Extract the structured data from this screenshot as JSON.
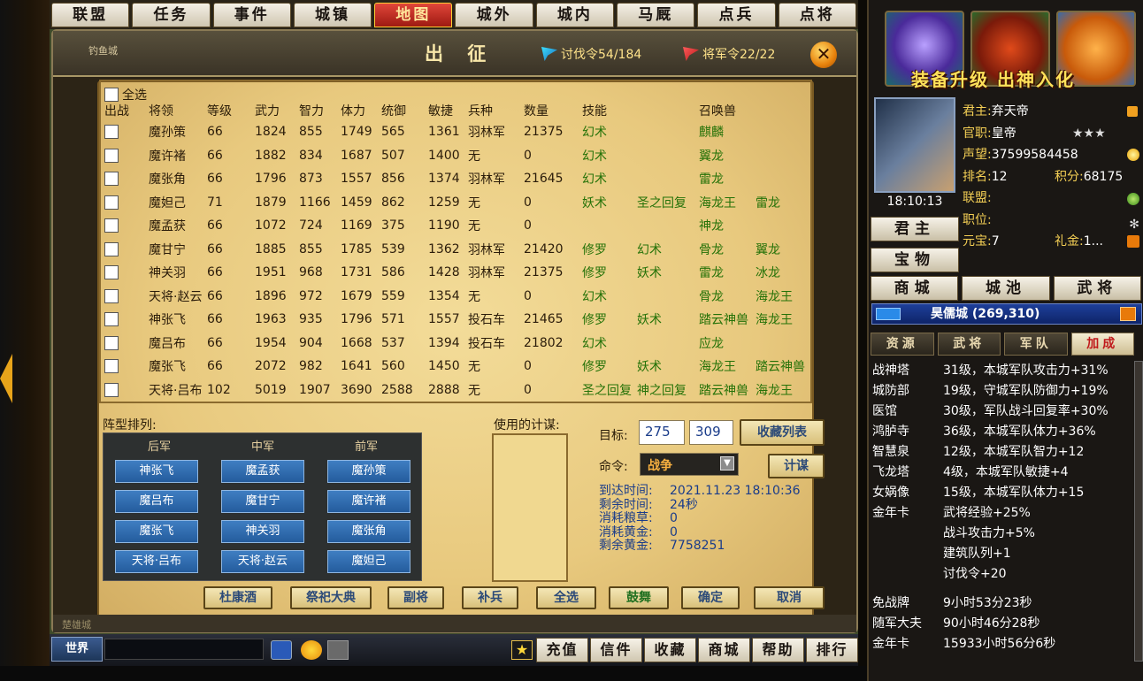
{
  "nav_tabs": [
    "联盟",
    "任务",
    "事件",
    "城镇",
    "地图",
    "城外",
    "城内",
    "马厩",
    "点兵",
    "点将"
  ],
  "nav_active": "地图",
  "map_labels": {
    "top_left": "钓鱼城",
    "bottom_left": "楚雄城"
  },
  "dialog": {
    "title": "出 征",
    "token_label": "讨伐令54/184",
    "general_token_label": "将军令22/22",
    "close_symbol": "✕"
  },
  "table": {
    "select_all": "全选",
    "headers": [
      "出战",
      "将领",
      "等级",
      "武力",
      "智力",
      "体力",
      "统御",
      "敏捷",
      "兵种",
      "数量",
      "技能",
      "",
      "召唤兽",
      ""
    ],
    "rows": [
      {
        "name": "魔孙策",
        "level": "66",
        "wu": "1824",
        "zhi": "855",
        "ti": "1749",
        "tong": "565",
        "min": "1361",
        "troop": "羽林军",
        "count": "21375",
        "skill1": "幻术",
        "skill2": "",
        "beast1": "麒麟",
        "beast2": ""
      },
      {
        "name": "魔许褚",
        "level": "66",
        "wu": "1882",
        "zhi": "834",
        "ti": "1687",
        "tong": "507",
        "min": "1400",
        "troop": "无",
        "count": "0",
        "skill1": "幻术",
        "skill2": "",
        "beast1": "翼龙",
        "beast2": ""
      },
      {
        "name": "魔张角",
        "level": "66",
        "wu": "1796",
        "zhi": "873",
        "ti": "1557",
        "tong": "856",
        "min": "1374",
        "troop": "羽林军",
        "count": "21645",
        "skill1": "幻术",
        "skill2": "",
        "beast1": "雷龙",
        "beast2": ""
      },
      {
        "name": "魔妲己",
        "level": "71",
        "wu": "1879",
        "zhi": "1166",
        "ti": "1459",
        "tong": "862",
        "min": "1259",
        "troop": "无",
        "count": "0",
        "skill1": "妖术",
        "skill2": "圣之回复",
        "beast1": "海龙王",
        "beast2": "雷龙"
      },
      {
        "name": "魔孟获",
        "level": "66",
        "wu": "1072",
        "zhi": "724",
        "ti": "1169",
        "tong": "375",
        "min": "1190",
        "troop": "无",
        "count": "0",
        "skill1": "",
        "skill2": "",
        "beast1": "神龙",
        "beast2": ""
      },
      {
        "name": "魔甘宁",
        "level": "66",
        "wu": "1885",
        "zhi": "855",
        "ti": "1785",
        "tong": "539",
        "min": "1362",
        "troop": "羽林军",
        "count": "21420",
        "skill1": "修罗",
        "skill2": "幻术",
        "beast1": "骨龙",
        "beast2": "翼龙"
      },
      {
        "name": "神关羽",
        "level": "66",
        "wu": "1951",
        "zhi": "968",
        "ti": "1731",
        "tong": "586",
        "min": "1428",
        "troop": "羽林军",
        "count": "21375",
        "skill1": "修罗",
        "skill2": "妖术",
        "beast1": "雷龙",
        "beast2": "冰龙"
      },
      {
        "name": "天将·赵云",
        "level": "66",
        "wu": "1896",
        "zhi": "972",
        "ti": "1679",
        "tong": "559",
        "min": "1354",
        "troop": "无",
        "count": "0",
        "skill1": "幻术",
        "skill2": "",
        "beast1": "骨龙",
        "beast2": "海龙王"
      },
      {
        "name": "神张飞",
        "level": "66",
        "wu": "1963",
        "zhi": "935",
        "ti": "1796",
        "tong": "571",
        "min": "1557",
        "troop": "投石车",
        "count": "21465",
        "skill1": "修罗",
        "skill2": "妖术",
        "beast1": "踏云神兽",
        "beast2": "海龙王"
      },
      {
        "name": "魔吕布",
        "level": "66",
        "wu": "1954",
        "zhi": "904",
        "ti": "1668",
        "tong": "537",
        "min": "1394",
        "troop": "投石车",
        "count": "21802",
        "skill1": "幻术",
        "skill2": "",
        "beast1": "应龙",
        "beast2": ""
      },
      {
        "name": "魔张飞",
        "level": "66",
        "wu": "2072",
        "zhi": "982",
        "ti": "1641",
        "tong": "560",
        "min": "1450",
        "troop": "无",
        "count": "0",
        "skill1": "修罗",
        "skill2": "妖术",
        "beast1": "海龙王",
        "beast2": "踏云神兽"
      },
      {
        "name": "天将·吕布",
        "level": "102",
        "wu": "5019",
        "zhi": "1907",
        "ti": "3690",
        "tong": "2588",
        "min": "2888",
        "troop": "无",
        "count": "0",
        "skill1": "圣之回复",
        "skill2": "神之回复",
        "beast1": "踏云神兽",
        "beast2": "海龙王"
      }
    ]
  },
  "formation": {
    "label": "阵型排列:",
    "columns": [
      "后军",
      "中军",
      "前军"
    ],
    "grid": [
      [
        "神张飞",
        "魔孟获",
        "魔孙策"
      ],
      [
        "魔吕布",
        "魔甘宁",
        "魔许褚"
      ],
      [
        "魔张飞",
        "神关羽",
        "魔张角"
      ],
      [
        "天将·吕布",
        "天将·赵云",
        "魔妲己"
      ]
    ]
  },
  "strategy": {
    "label": "使用的计谋:"
  },
  "target": {
    "label": "目标:",
    "x": "275",
    "y": "309",
    "fav_button": "收藏列表",
    "command_label": "命令:",
    "command_value": "战争",
    "plan_button": "计谋",
    "arrive_label": "到达时间:",
    "arrive_value": "2021.11.23  18:10:36",
    "remain_label": "剩余时间:",
    "remain_value": "24秒",
    "food_label": "消耗粮草:",
    "food_value": "0",
    "gold_label": "消耗黄金:",
    "gold_value": "0",
    "gold_left_label": "剩余黄金:",
    "gold_left_value": "7758251"
  },
  "action_buttons": [
    "杜康酒",
    "祭祀大典",
    "副将",
    "补兵",
    "全选",
    "鼓舞",
    "确定",
    "取消"
  ],
  "chat": {
    "world_label": "世界"
  },
  "bottom_buttons": [
    "充值",
    "信件",
    "收藏",
    "商城",
    "帮助",
    "排行"
  ],
  "right_panel": {
    "banner": "装备升级 出神入化",
    "time": "18:10:13",
    "lord": {
      "label": "君主:",
      "value": "弃天帝"
    },
    "office": {
      "label": "官职:",
      "value": "皇帝",
      "stars": "★★★"
    },
    "fame": {
      "label": "声望:",
      "value": "37599584458"
    },
    "rank": {
      "label": "排名:",
      "value": "12"
    },
    "score": {
      "label": "积分:",
      "value": "68175"
    },
    "alliance": {
      "label": "联盟:",
      "value": ""
    },
    "duty": {
      "label": "职位:",
      "value": ""
    },
    "yuanbao": {
      "label": "元宝:",
      "value": "7"
    },
    "lijin": {
      "label": "礼金:",
      "value": "1..."
    },
    "side_buttons": [
      "君主",
      "宝物"
    ],
    "row_buttons": [
      "商城",
      "城池",
      "武将"
    ],
    "city": "昊儒城 (269,310)",
    "tabs": [
      "资源",
      "武将",
      "军队",
      "加成"
    ],
    "active_tab": "加成",
    "buffs": [
      {
        "name": "战神塔",
        "desc": "31级，本城军队攻击力+31%"
      },
      {
        "name": "城防部",
        "desc": "19级，守城军队防御力+19%"
      },
      {
        "name": "医馆",
        "desc": "30级，军队战斗回复率+30%"
      },
      {
        "name": "鸿胪寺",
        "desc": "36级，本城军队体力+36%"
      },
      {
        "name": "智慧泉",
        "desc": "12级，本城军队智力+12"
      },
      {
        "name": "飞龙塔",
        "desc": "4级，本城军队敏捷+4"
      },
      {
        "name": "女娲像",
        "desc": "15级，本城军队体力+15"
      },
      {
        "name": "金年卡",
        "desc": "武将经验+25%"
      },
      {
        "name": "",
        "desc": "战斗攻击力+5%"
      },
      {
        "name": "",
        "desc": "建筑队列+1"
      },
      {
        "name": "",
        "desc": "讨伐令+20"
      }
    ],
    "timers": [
      {
        "name": "免战牌",
        "desc": "9小时53分23秒"
      },
      {
        "name": "随军大夫",
        "desc": "90小时46分28秒"
      },
      {
        "name": "金年卡",
        "desc": "15933小时56分6秒"
      }
    ]
  }
}
